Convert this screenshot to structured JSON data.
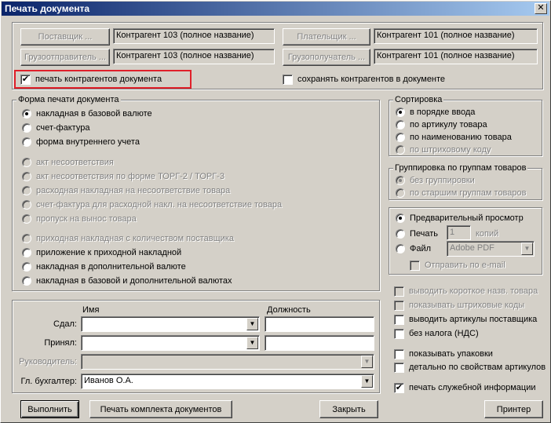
{
  "window": {
    "title": "Печать документа",
    "close_glyph": "✕"
  },
  "parties": {
    "supplier_btn": "Поставщик ...",
    "supplier_value": "Контрагент 103 (полное название)",
    "shipper_btn": "Грузоотправитель ...",
    "shipper_value": "Контрагент 103 (полное название)",
    "payer_btn": "Плательщик ...",
    "payer_value": "Контрагент 101 (полное название)",
    "consignee_btn": "Грузополучатель ...",
    "consignee_value": "Контрагент 101 (полное название)",
    "print_contractors": "печать контрагентов документа",
    "save_contractors": "сохранять контрагентов в документе"
  },
  "print_form": {
    "title": "Форма печати документа",
    "options": [
      "накладная в базовой валюте",
      "счет-фактура",
      "форма внутреннего учета",
      "акт несоответствия",
      "акт несоответствия по форме ТОРГ-2 / ТОРГ-3",
      "расходная накладная на несоответствие товара",
      "счет-фактура для расходной накл. на несоответствие товара",
      "пропуск на вынос товара",
      "приходная накладная с количеством поставщика",
      "приложение к приходной накладной",
      "накладная в дополнительной валюте",
      "накладная в базовой и дополнительной валютах"
    ]
  },
  "sort": {
    "title": "Сортировка",
    "options": [
      "в порядке ввода",
      "по артикулу товара",
      "по наименованию товара",
      "по штриховому коду"
    ]
  },
  "grouping": {
    "title": "Группировка по группам товаров",
    "options": [
      "без группировки",
      "по старшим группам товаров"
    ]
  },
  "output": {
    "preview": "Предварительный просмотр",
    "print": "Печать",
    "copies_value": "1",
    "copies_label": "копий",
    "file": "Файл",
    "file_format": "Adobe PDF",
    "send_email": "Отправить по e-mail"
  },
  "options": [
    "выводить короткое назв. товара",
    "показывать штриховые коды",
    "выводить артикулы поставщика",
    "без налога (НДС)",
    "показывать упаковки",
    "детально по свойствам артикулов",
    "печать служебной информации"
  ],
  "signers": {
    "col_name": "Имя",
    "col_position": "Должность",
    "handed": "Сдал:",
    "received": "Принял:",
    "head": "Руководитель:",
    "chief_accountant": "Гл. бухгалтер:",
    "chief_accountant_value": "Иванов О.А."
  },
  "buttons": {
    "execute": "Выполнить",
    "print_set": "Печать комплекта документов",
    "close": "Закрыть",
    "printer": "Принтер"
  },
  "icons": {
    "check": "✔",
    "dropdown": "▼"
  },
  "colors": {
    "title_start": "#0a246a",
    "title_end": "#a6caf0",
    "highlight": "#e0202a",
    "face": "#d4d0c8"
  }
}
